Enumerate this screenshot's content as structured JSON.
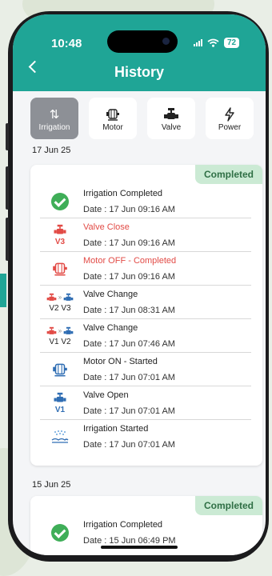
{
  "status_bar": {
    "time": "10:48",
    "battery": "72"
  },
  "header": {
    "title": "History"
  },
  "tabs": [
    {
      "label": "Irrigation",
      "icon": "arrows-icon",
      "active": true
    },
    {
      "label": "Motor",
      "icon": "motor-icon"
    },
    {
      "label": "Valve",
      "icon": "valve-icon"
    },
    {
      "label": "Power",
      "icon": "bolt-icon"
    }
  ],
  "days": [
    {
      "date": "17 Jun 25",
      "status": "Completed",
      "events": [
        {
          "title": "Irrigation Completed",
          "date": "Date  :  17 Jun  09:16 AM",
          "icon": "check-icon"
        },
        {
          "title": "Valve Close",
          "date": "Date  :  17 Jun  09:16 AM",
          "icon": "valve-icon",
          "sub": "V3"
        },
        {
          "title": "Motor OFF   -   Completed",
          "date": "Date  :  17 Jun  09:16 AM",
          "icon": "motor-icon"
        },
        {
          "title": "Valve Change",
          "date": "Date  :  17 Jun  08:31 AM",
          "icon": "valve-change-icon",
          "sub": "V2  V3"
        },
        {
          "title": "Valve Change",
          "date": "Date  :  17 Jun  07:46 AM",
          "icon": "valve-change-icon",
          "sub": "V1  V2"
        },
        {
          "title": "Motor ON   -   Started",
          "date": "Date  :  17 Jun  07:01 AM",
          "icon": "motor-icon"
        },
        {
          "title": "Valve Open",
          "date": "Date  :  17 Jun  07:01 AM",
          "icon": "valve-icon",
          "sub": "V1"
        },
        {
          "title": "Irrigation Started",
          "date": "Date  :  17 Jun  07:01 AM",
          "icon": "sprinkler-icon"
        }
      ]
    },
    {
      "date": "15 Jun 25",
      "status": "Completed",
      "events": [
        {
          "title": "Irrigation Completed",
          "date": "Date  :  15 Jun  06:49 PM",
          "icon": "check-icon"
        }
      ]
    }
  ],
  "colors": {
    "primary": "#1fa596",
    "red": "#e24b46",
    "blue": "#2f6db3",
    "green": "#3fae58",
    "badge_bg": "#cbead4"
  }
}
